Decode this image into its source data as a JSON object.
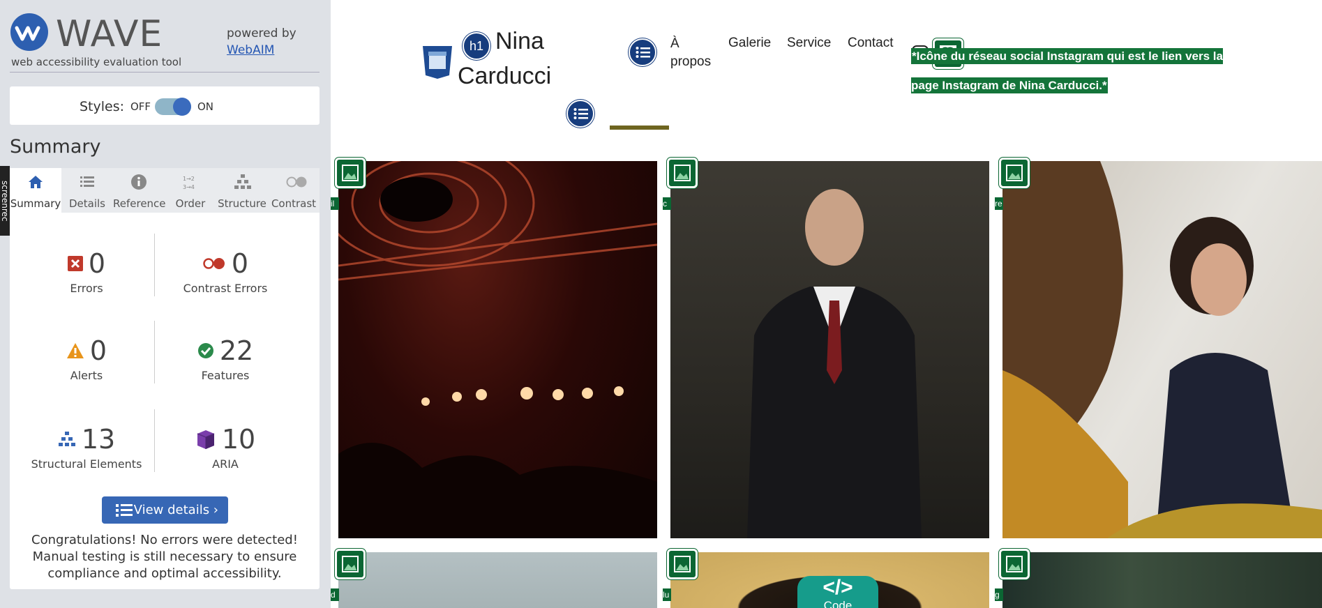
{
  "wave": {
    "title": "WAVE",
    "subtitle": "web accessibility evaluation tool",
    "powered_by": "powered by",
    "webaim": "WebAIM",
    "styles_label": "Styles:",
    "styles_off": "OFF",
    "styles_on": "ON",
    "summary_heading": "Summary",
    "screenrec": "screenrec",
    "tabs": [
      {
        "label": "Summary",
        "icon": "home-icon"
      },
      {
        "label": "Details",
        "icon": "list-icon"
      },
      {
        "label": "Reference",
        "icon": "info-icon"
      },
      {
        "label": "Order",
        "icon": "order-icon"
      },
      {
        "label": "Structure",
        "icon": "structure-icon"
      },
      {
        "label": "Contrast",
        "icon": "contrast-icon"
      }
    ],
    "stats": {
      "errors": {
        "value": "0",
        "label": "Errors"
      },
      "contrast_errors": {
        "value": "0",
        "label": "Contrast Errors"
      },
      "alerts": {
        "value": "0",
        "label": "Alerts"
      },
      "features": {
        "value": "22",
        "label": "Features"
      },
      "structural": {
        "value": "13",
        "label": "Structural Elements"
      },
      "aria": {
        "value": "10",
        "label": "ARIA"
      }
    },
    "view_details": "View details ›",
    "congrats": "Congratulations! No errors were detected! Manual testing is still necessary to ensure compliance and optimal accessibility."
  },
  "site": {
    "h1_badge": "h1",
    "brand_line1": "Nina",
    "brand_line2": "Carducci",
    "nav": [
      "À propos",
      "Galerie",
      "Service",
      "Contact"
    ],
    "instagram_alt": "*Icône du réseau social Instagram qui est le lien vers la page Instagram de Nina Carducci.*",
    "code_badge": "</>",
    "code_label": "Code",
    "photo_chips": [
      "il",
      "c",
      "re",
      "d",
      "lu",
      "g"
    ]
  },
  "colors": {
    "wave_blue": "#3767b5",
    "feature_green": "#0b6633",
    "nav_underline": "#6e6520"
  }
}
